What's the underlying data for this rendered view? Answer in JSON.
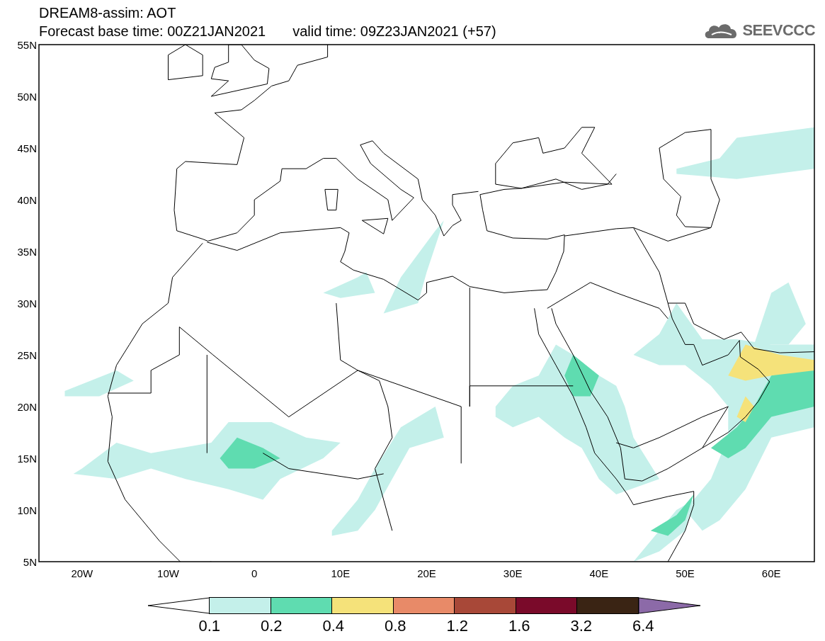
{
  "header": {
    "title": "DREAM8-assim: AOT",
    "base_time": "Forecast base time: 00Z21JAN2021",
    "valid_time": "valid time: 09Z23JAN2021 (+57)"
  },
  "logo": {
    "text": "SEEVCCC"
  },
  "map": {
    "y_labels": [
      "55N",
      "50N",
      "45N",
      "40N",
      "35N",
      "30N",
      "25N",
      "20N",
      "15N",
      "10N",
      "5N"
    ],
    "x_labels": [
      "20W",
      "10W",
      "0",
      "10E",
      "20E",
      "30E",
      "40E",
      "50E",
      "60E"
    ]
  },
  "colorbar": {
    "segments": [
      {
        "color": "#ffffff"
      },
      {
        "color": "#c4f0ea"
      },
      {
        "color": "#5fdcb0"
      },
      {
        "color": "#f5e27a"
      },
      {
        "color": "#e88a68"
      },
      {
        "color": "#a84838"
      },
      {
        "color": "#7a0a2a"
      },
      {
        "color": "#3a2414"
      },
      {
        "color": "#8c6aa8"
      }
    ],
    "labels": [
      "0.1",
      "0.2",
      "0.4",
      "0.8",
      "1.2",
      "1.6",
      "3.2",
      "6.4"
    ]
  }
}
